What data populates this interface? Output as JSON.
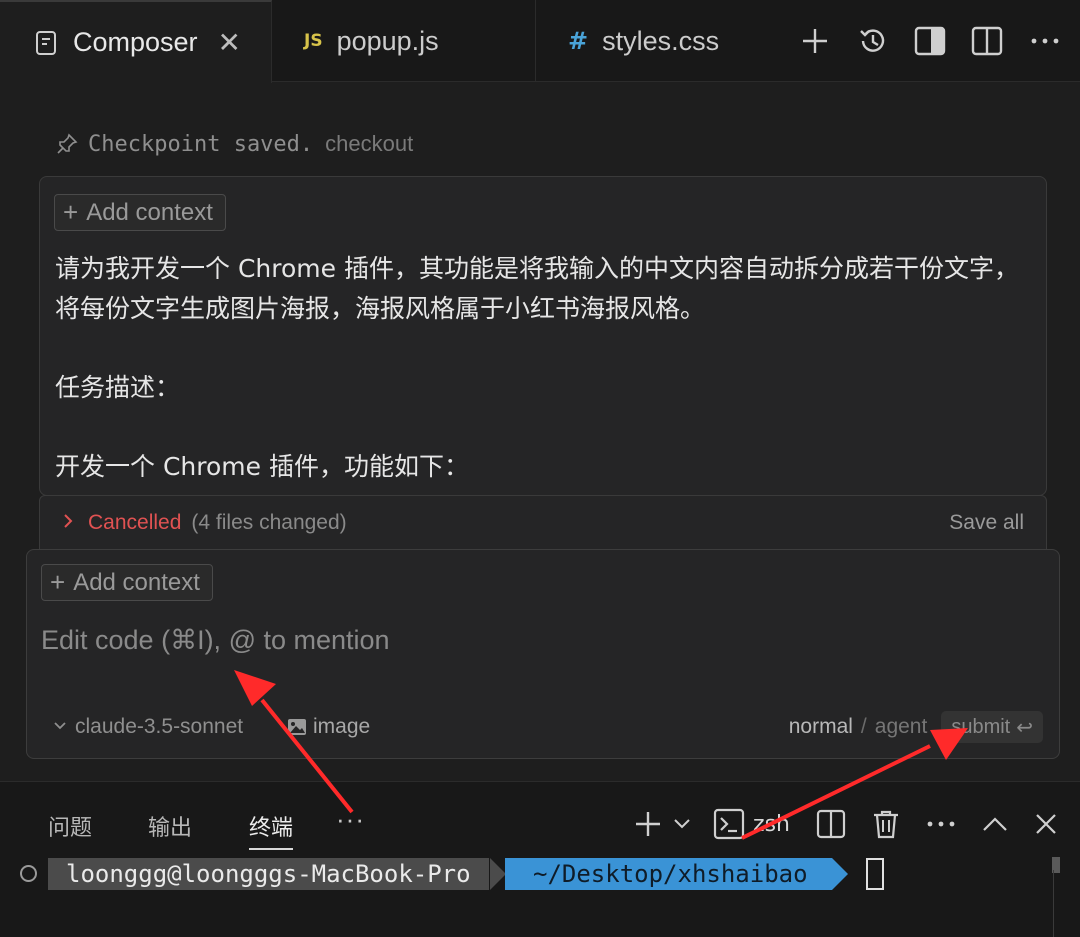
{
  "tabs": [
    {
      "label": "Composer",
      "icon": "composer-icon",
      "active": true
    },
    {
      "label": "popup.js",
      "icon": "js-file-icon",
      "badge": "JS"
    },
    {
      "label": "styles.css",
      "icon": "css-file-icon",
      "badge": "#"
    }
  ],
  "checkpoint": {
    "text": "Checkpoint saved.",
    "link": "checkout"
  },
  "message": {
    "add_context": "Add context",
    "paragraphs": [
      "请为我开发一个 Chrome 插件，其功能是将我输入的中文内容自动拆分成若干份文字，将每份文字生成图片海报，海报风格属于小红书海报风格。",
      "任务描述：",
      "开发一个 Chrome 插件，功能如下："
    ]
  },
  "cancel_bar": {
    "status": "Cancelled",
    "count": "(4 files changed)",
    "save_all": "Save all"
  },
  "composer_input": {
    "add_context": "Add context",
    "placeholder": "Edit code (⌘I), @ to mention",
    "model": "claude-3.5-sonnet",
    "image": "image",
    "mode_normal": "normal",
    "mode_sep": "/",
    "mode_agent": "agent",
    "submit": "submit",
    "submit_key": "↩"
  },
  "panel": {
    "tabs": [
      "问题",
      "输出",
      "终端"
    ],
    "active_tab": "终端",
    "more": "···",
    "shell": "zsh"
  },
  "terminal": {
    "user_host": "loonggg@loongggs-MacBook-Pro",
    "path": "~/Desktop/xhshaibao"
  },
  "colors": {
    "accent_red": "#e05252",
    "path_blue": "#3a93d6",
    "arrow_red": "#ff2a2a"
  }
}
